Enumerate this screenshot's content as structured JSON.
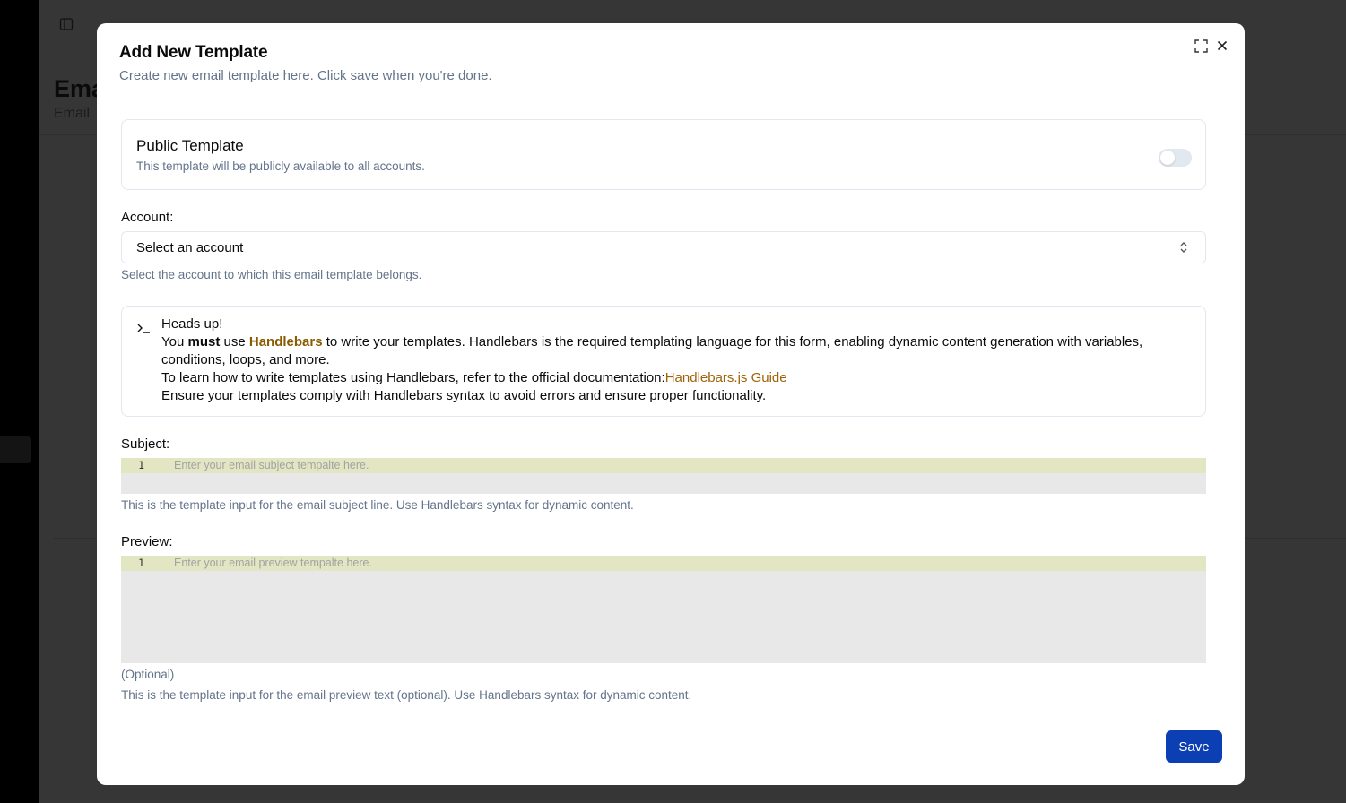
{
  "background": {
    "page_title": "Ema",
    "page_subtitle": "Email"
  },
  "dialog": {
    "title": "Add New Template",
    "description": "Create new email template here. Click save when you're done.",
    "public_template": {
      "title": "Public Template",
      "description": "This template will be publicly available to all accounts.",
      "enabled": false
    },
    "account": {
      "label": "Account:",
      "selected": "Select an account",
      "hint": "Select the account to which this email template belongs."
    },
    "alert": {
      "title": "Heads up!",
      "line1_prefix": "You ",
      "line1_must": "must",
      "line1_use": " use ",
      "line1_handlebars": "Handlebars",
      "line1_suffix": " to write your templates. Handlebars is the required templating language for this form, enabling dynamic content generation with variables, conditions, loops, and more.",
      "line2_prefix": "To learn how to write templates using Handlebars, refer to the official documentation:",
      "line2_link": "Handlebars.js Guide",
      "line3": "Ensure your templates comply with Handlebars syntax to avoid errors and ensure proper functionality."
    },
    "subject": {
      "label": "Subject:",
      "line_number": "1",
      "placeholder": "Enter your email subject tempalte here.",
      "hint": "This is the template input for the email subject line. Use Handlebars syntax for dynamic content."
    },
    "preview": {
      "label": "Preview:",
      "line_number": "1",
      "placeholder": "Enter your email preview tempalte here.",
      "optional": "(Optional)",
      "hint": "This is the template input for the email preview text (optional). Use Handlebars syntax for dynamic content."
    },
    "save_label": "Save"
  },
  "colors": {
    "save_button": "#0b3fb3",
    "link": "#a16207",
    "overlay": "#363636"
  }
}
